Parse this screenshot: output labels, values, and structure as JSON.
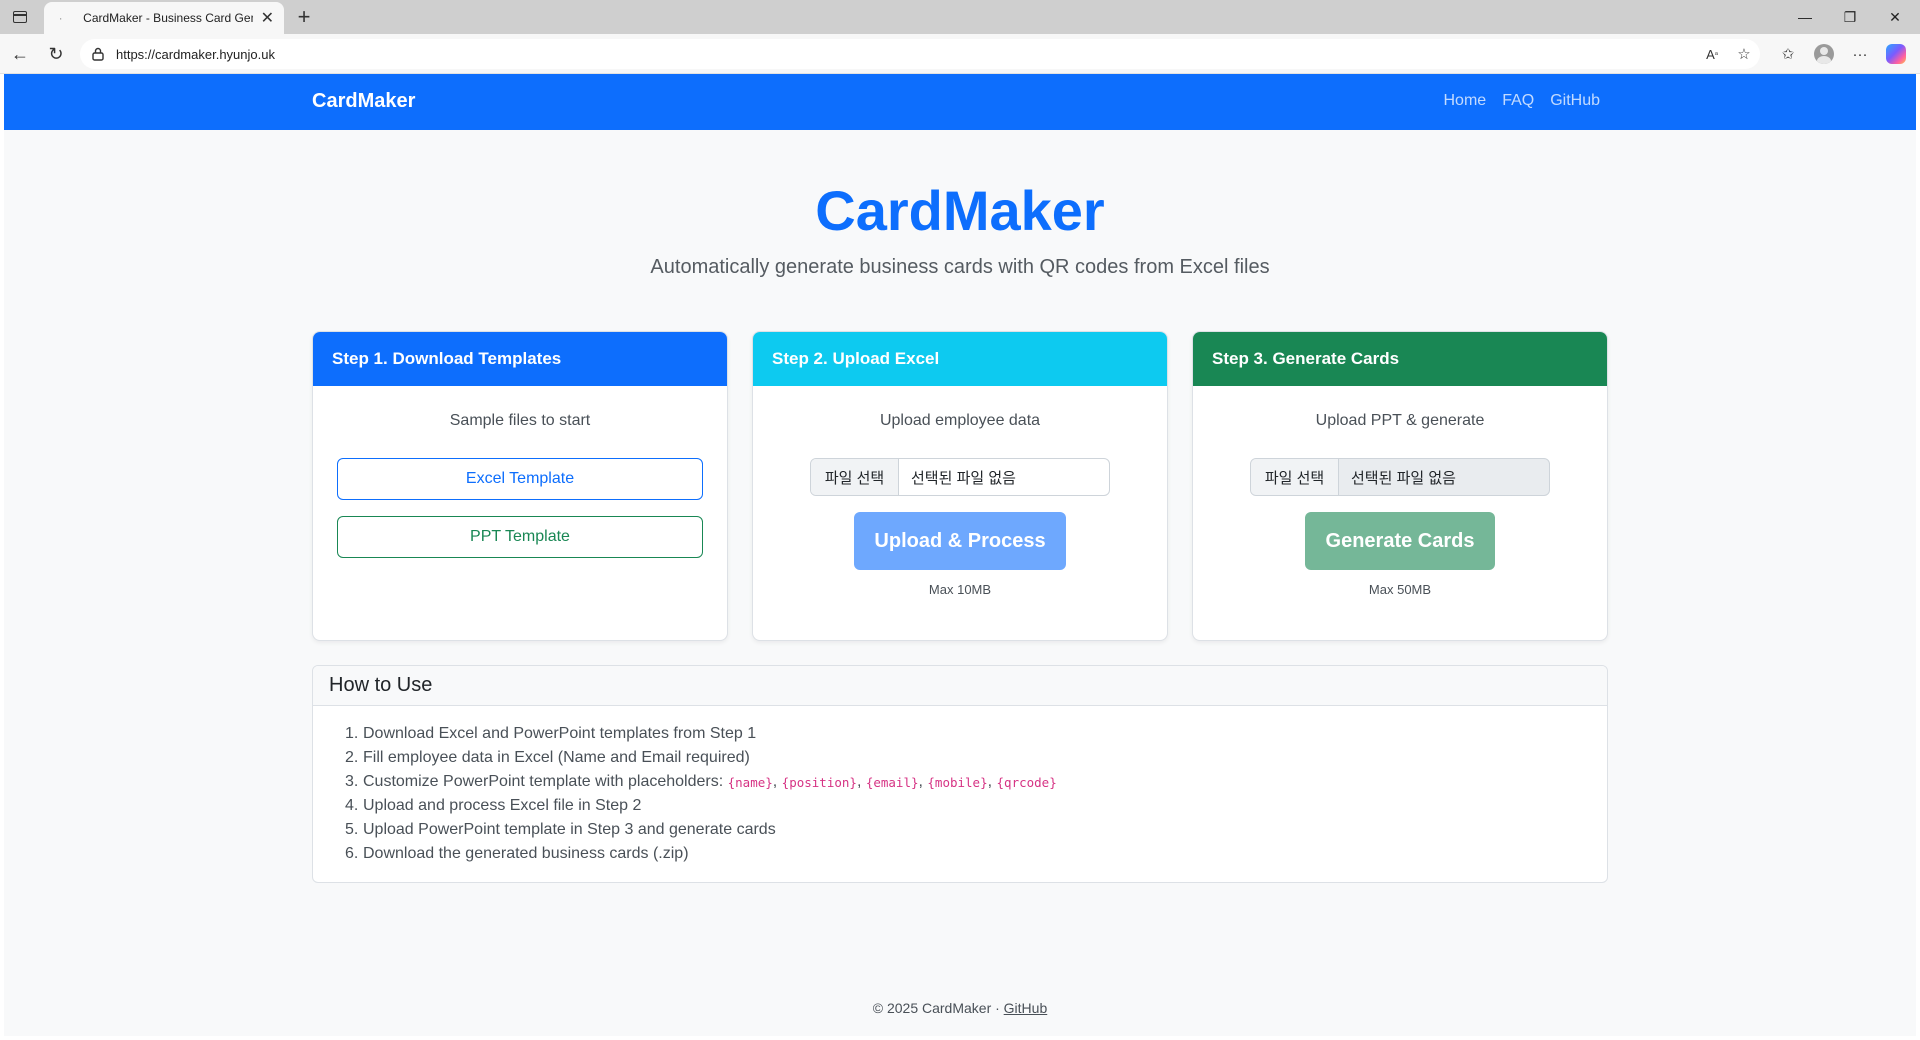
{
  "browser": {
    "tab_title": "CardMaker - Business Card Generator",
    "url": "https://cardmaker.hyunjo.uk"
  },
  "site": {
    "brand": "CardMaker",
    "nav": [
      "Home",
      "FAQ",
      "GitHub"
    ]
  },
  "hero": {
    "title": "CardMaker",
    "subtitle": "Automatically generate business cards with QR codes from Excel files"
  },
  "steps": [
    {
      "header": "Step 1. Download Templates",
      "description": "Sample files to start",
      "buttons": [
        "Excel Template",
        "PPT Template"
      ],
      "color": "#0d6efd"
    },
    {
      "header": "Step 2. Upload Excel",
      "description": "Upload employee data",
      "file_button": "파일 선택",
      "file_status": "선택된 파일 없음",
      "action": "Upload & Process",
      "note": "Max 10MB",
      "color": "#0dcaf0"
    },
    {
      "header": "Step 3. Generate Cards",
      "description": "Upload PPT & generate",
      "file_button": "파일 선택",
      "file_status": "선택된 파일 없음",
      "action": "Generate Cards",
      "note": "Max 50MB",
      "color": "#198754"
    }
  ],
  "how_to": {
    "title": "How to Use",
    "items": [
      {
        "num": "1.",
        "text": "Download Excel and PowerPoint templates from Step 1"
      },
      {
        "num": "2.",
        "text": "Fill employee data in Excel (Name and Email required)"
      },
      {
        "num": "3.",
        "text": "Customize PowerPoint template with placeholders: ",
        "placeholders": [
          "{name}",
          "{position}",
          "{email}",
          "{mobile}",
          "{qrcode}"
        ]
      },
      {
        "num": "4.",
        "text": "Upload and process Excel file in Step 2"
      },
      {
        "num": "5.",
        "text": "Upload PowerPoint template in Step 3 and generate cards"
      },
      {
        "num": "6.",
        "text": "Download the generated business cards (.zip)"
      }
    ]
  },
  "footer": {
    "text": "© 2025 CardMaker · ",
    "link": "GitHub"
  }
}
